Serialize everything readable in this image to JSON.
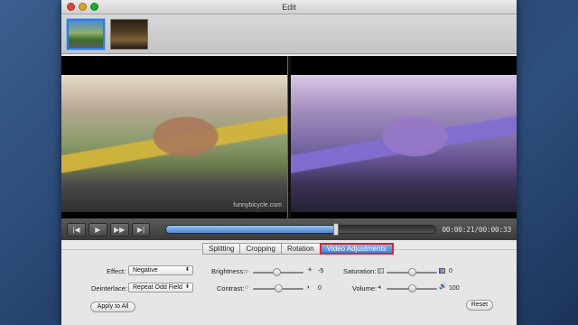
{
  "window": {
    "title": "Edit"
  },
  "thumbnails": [
    {
      "name": "clip-1",
      "selected": true
    },
    {
      "name": "clip-2",
      "selected": false
    }
  ],
  "preview": {
    "watermark": "funnybicycle.com"
  },
  "player": {
    "buttons": [
      "skip-back-icon",
      "play-icon",
      "fast-forward-icon",
      "skip-end-icon"
    ],
    "button_glyphs": [
      "|◀",
      "▶",
      "▶▶",
      "▶|"
    ],
    "progress_fraction": 0.63,
    "timecode": "00:00:21/00:00:33"
  },
  "tabs": [
    {
      "label": "Splitting",
      "active": false
    },
    {
      "label": "Cropping",
      "active": false
    },
    {
      "label": "Rotation",
      "active": false
    },
    {
      "label": "Video Adjustments",
      "active": true
    }
  ],
  "adjustments": {
    "effect_label": "Effect:",
    "effect_value": "Negative",
    "deinterlace_label": "Deinterlace:",
    "deinterlace_value": "Repeat Odd Field",
    "brightness_label": "Brightness:",
    "brightness_value": "-5",
    "contrast_label": "Contrast:",
    "contrast_value": "0",
    "saturation_label": "Saturation:",
    "saturation_value": "0",
    "volume_label": "Volume:",
    "volume_value": "100",
    "apply_all_label": "Apply to All",
    "reset_label": "Reset"
  },
  "colors": {
    "accent": "#3a86de",
    "highlight_border": "#e0262c"
  }
}
